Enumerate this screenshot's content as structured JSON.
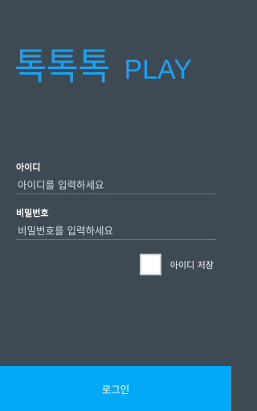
{
  "logo": {
    "main_text": "톡톡톡",
    "play_text": "PLAY"
  },
  "id_field": {
    "label": "아이디",
    "placeholder": "아이디를 입력하세요",
    "value": ""
  },
  "password_field": {
    "label": "비밀번호",
    "placeholder": "비밀번호를 입력하세요",
    "value": ""
  },
  "remember_id": {
    "label": "아이디 저장",
    "checked": false
  },
  "login_button": {
    "label": "로그인"
  },
  "colors": {
    "background": "#3d4a54",
    "accent": "#1da1f2",
    "button": "#03a9f4"
  }
}
